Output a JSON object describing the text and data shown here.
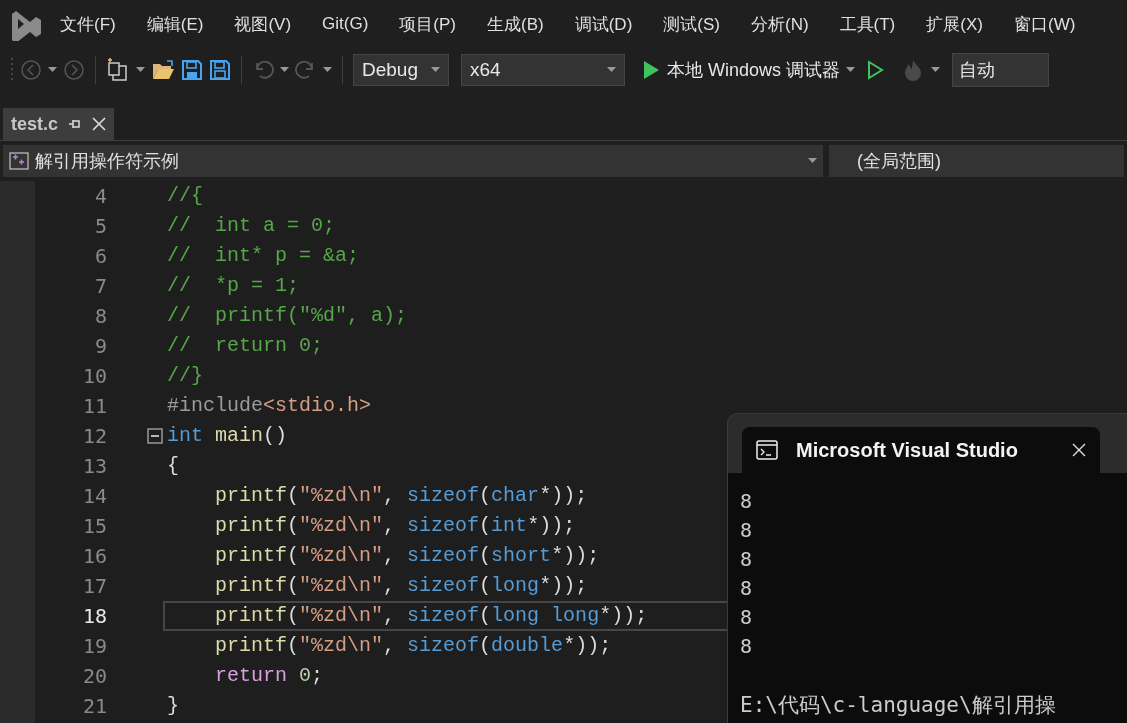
{
  "menu": [
    "文件(F)",
    "编辑(E)",
    "视图(V)",
    "Git(G)",
    "项目(P)",
    "生成(B)",
    "调试(D)",
    "测试(S)",
    "分析(N)",
    "工具(T)",
    "扩展(X)",
    "窗口(W)"
  ],
  "toolbar": {
    "configuration": "Debug",
    "platform": "x64",
    "run_label": "本地 Windows 调试器",
    "zoom_field": "自动"
  },
  "tabs": [
    {
      "label": "test.c",
      "selected": true
    }
  ],
  "navigation": {
    "scope": "解引用操作符示例",
    "member": "(全局范围)"
  },
  "editor": {
    "lines": [
      {
        "number": "4",
        "current": false,
        "fold": false,
        "segments": [
          {
            "text": "//{",
            "kind": "comment"
          }
        ]
      },
      {
        "number": "5",
        "current": false,
        "fold": false,
        "segments": [
          {
            "text": "//  int a = 0;",
            "kind": "comment"
          }
        ]
      },
      {
        "number": "6",
        "current": false,
        "fold": false,
        "segments": [
          {
            "text": "//  int* p = &a;",
            "kind": "comment"
          }
        ]
      },
      {
        "number": "7",
        "current": false,
        "fold": false,
        "segments": [
          {
            "text": "//  *p = 1;",
            "kind": "comment"
          }
        ]
      },
      {
        "number": "8",
        "current": false,
        "fold": false,
        "segments": [
          {
            "text": "//  printf(\"%d\", a);",
            "kind": "comment"
          }
        ]
      },
      {
        "number": "9",
        "current": false,
        "fold": false,
        "segments": [
          {
            "text": "//  return 0;",
            "kind": "comment"
          }
        ]
      },
      {
        "number": "10",
        "current": false,
        "fold": false,
        "segments": [
          {
            "text": "//}",
            "kind": "comment"
          }
        ]
      },
      {
        "number": "11",
        "current": false,
        "fold": false,
        "segments": [
          {
            "text": "#include",
            "kind": "preproc"
          },
          {
            "text": "<stdio.h>",
            "kind": "string"
          }
        ]
      },
      {
        "number": "12",
        "current": false,
        "fold": true,
        "segments": [
          {
            "text": "int",
            "kind": "keyword"
          },
          {
            "text": " main",
            "kind": "func"
          },
          {
            "text": "()",
            "kind": "plain"
          }
        ]
      },
      {
        "number": "13",
        "current": false,
        "fold": false,
        "segments": [
          {
            "text": "{",
            "kind": "plain"
          }
        ]
      },
      {
        "number": "14",
        "current": false,
        "fold": false,
        "segments": [
          {
            "text": "    printf",
            "kind": "func"
          },
          {
            "text": "(",
            "kind": "plain"
          },
          {
            "text": "\"%zd\\n\"",
            "kind": "string"
          },
          {
            "text": ", ",
            "kind": "plain"
          },
          {
            "text": "sizeof",
            "kind": "keyword"
          },
          {
            "text": "(",
            "kind": "plain"
          },
          {
            "text": "char",
            "kind": "keyword"
          },
          {
            "text": "*));",
            "kind": "plain"
          }
        ]
      },
      {
        "number": "15",
        "current": false,
        "fold": false,
        "segments": [
          {
            "text": "    printf",
            "kind": "func"
          },
          {
            "text": "(",
            "kind": "plain"
          },
          {
            "text": "\"%zd\\n\"",
            "kind": "string"
          },
          {
            "text": ", ",
            "kind": "plain"
          },
          {
            "text": "sizeof",
            "kind": "keyword"
          },
          {
            "text": "(",
            "kind": "plain"
          },
          {
            "text": "int",
            "kind": "keyword"
          },
          {
            "text": "*));",
            "kind": "plain"
          }
        ]
      },
      {
        "number": "16",
        "current": false,
        "fold": false,
        "segments": [
          {
            "text": "    printf",
            "kind": "func"
          },
          {
            "text": "(",
            "kind": "plain"
          },
          {
            "text": "\"%zd\\n\"",
            "kind": "string"
          },
          {
            "text": ", ",
            "kind": "plain"
          },
          {
            "text": "sizeof",
            "kind": "keyword"
          },
          {
            "text": "(",
            "kind": "plain"
          },
          {
            "text": "short",
            "kind": "keyword"
          },
          {
            "text": "*));",
            "kind": "plain"
          }
        ]
      },
      {
        "number": "17",
        "current": false,
        "fold": false,
        "segments": [
          {
            "text": "    printf",
            "kind": "func"
          },
          {
            "text": "(",
            "kind": "plain"
          },
          {
            "text": "\"%zd\\n\"",
            "kind": "string"
          },
          {
            "text": ", ",
            "kind": "plain"
          },
          {
            "text": "sizeof",
            "kind": "keyword"
          },
          {
            "text": "(",
            "kind": "plain"
          },
          {
            "text": "long",
            "kind": "keyword"
          },
          {
            "text": "*));",
            "kind": "plain"
          }
        ]
      },
      {
        "number": "18",
        "current": true,
        "fold": false,
        "segments": [
          {
            "text": "    printf",
            "kind": "func"
          },
          {
            "text": "(",
            "kind": "plain"
          },
          {
            "text": "\"%zd\\n\"",
            "kind": "string"
          },
          {
            "text": ", ",
            "kind": "plain"
          },
          {
            "text": "sizeof",
            "kind": "keyword"
          },
          {
            "text": "(",
            "kind": "plain"
          },
          {
            "text": "long long",
            "kind": "keyword"
          },
          {
            "text": "*));",
            "kind": "plain"
          }
        ]
      },
      {
        "number": "19",
        "current": false,
        "fold": false,
        "segments": [
          {
            "text": "    printf",
            "kind": "func"
          },
          {
            "text": "(",
            "kind": "plain"
          },
          {
            "text": "\"%zd\\n\"",
            "kind": "string"
          },
          {
            "text": ", ",
            "kind": "plain"
          },
          {
            "text": "sizeof",
            "kind": "keyword"
          },
          {
            "text": "(",
            "kind": "plain"
          },
          {
            "text": "double",
            "kind": "keyword"
          },
          {
            "text": "*));",
            "kind": "plain"
          }
        ]
      },
      {
        "number": "20",
        "current": false,
        "fold": false,
        "segments": [
          {
            "text": "    return",
            "kind": "control"
          },
          {
            "text": " 0",
            "kind": "number"
          },
          {
            "text": ";",
            "kind": "plain"
          }
        ]
      },
      {
        "number": "21",
        "current": false,
        "fold": false,
        "segments": [
          {
            "text": "}",
            "kind": "plain"
          }
        ]
      }
    ]
  },
  "console": {
    "title": "Microsoft Visual Studio",
    "output": [
      "8",
      "8",
      "8",
      "8",
      "8",
      "8"
    ],
    "path_line": "E:\\代码\\c-language\\解引用操"
  }
}
